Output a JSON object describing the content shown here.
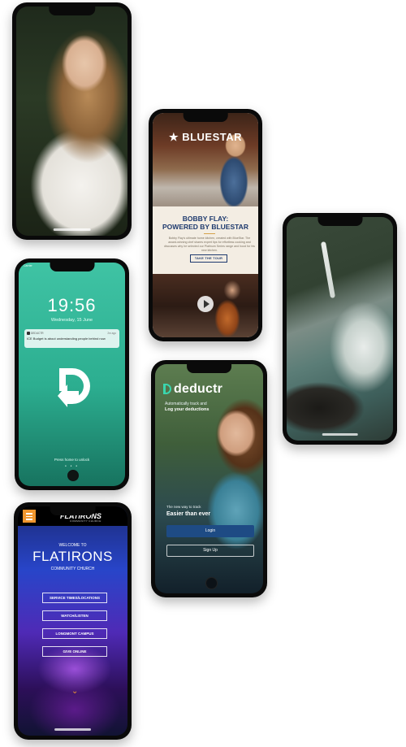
{
  "phone1": {},
  "phone2": {
    "logo": "★ BLUESTAR",
    "headline_line1": "BOBBY FLAY:",
    "headline_line2": "POWERED BY BLUESTAR",
    "body": "Bobby Flay's ultimate home kitchen, created with BlueStar. The award-winning chef shares expert tips for effortless cooking and discusses why he selected our Platinum Series range and hood for his new kitchen.",
    "button": "TAKE THE TOUR"
  },
  "phone3": {},
  "phone4": {
    "status": "Carrier",
    "time": "19:56",
    "date": "Wednesday, 15 June",
    "notification": {
      "app": "DEDUCTR",
      "time": "2m ago",
      "text": "ICE Budget is about understanding people behind now"
    },
    "hint": "Press home to unlock",
    "dots": "● ● ●"
  },
  "phone5": {
    "logo": "deductr",
    "tagline1": "Automatically track and",
    "tagline2": "Log your deductions",
    "sub1": "The new way to track",
    "sub2": "Easier than ever",
    "login": "Login",
    "signup": "Sign Up"
  },
  "phone6": {
    "logo": "FLATIRONS",
    "logo_sub": "COMMUNITY CHURCH",
    "welcome": "WELCOME TO",
    "title": "FLATIRONS",
    "cc": "COMMUNITY CHURCH",
    "buttons": [
      "SERVICE TIMES/LOCATIONS",
      "WATCH/LISTEN",
      "LONGMONT CAMPUS",
      "GIVE ONLINE"
    ],
    "chevron": "⌄"
  }
}
